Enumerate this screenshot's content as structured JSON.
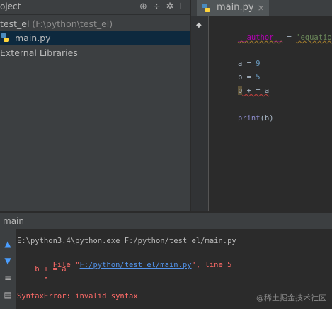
{
  "project_panel": {
    "title": "oject",
    "items": [
      {
        "name": "test_el",
        "path": "(F:\\python\\test_el)"
      },
      {
        "name": "main.py"
      },
      {
        "name": "External Libraries"
      }
    ]
  },
  "editor": {
    "tab_label": "main.py",
    "code": {
      "author_name": "__author__",
      "author_eq": " = ",
      "author_val": "'equation'",
      "a_var": "a = ",
      "a_num": "9",
      "b_var": "b = ",
      "b_num": "5",
      "line3_b": "b",
      "line3_rest": " + = a",
      "print_fn": "print",
      "print_arg": "(b)"
    }
  },
  "run_panel": {
    "title": "main",
    "console": {
      "cmd": "E:\\python3.4\\python.exe F:/python/test_el/main.py",
      "file_prefix": "  File \"",
      "file_link": "F:/python/test_el/main.py",
      "file_suffix": "\", line 5",
      "code": "    b + = a",
      "caret": "      ^",
      "error": "SyntaxError: invalid syntax"
    }
  },
  "watermark": "@稀土掘金技术社区",
  "colors": {
    "error": "#ff6b68",
    "link": "#5394ec",
    "accent": "#0d293e"
  }
}
